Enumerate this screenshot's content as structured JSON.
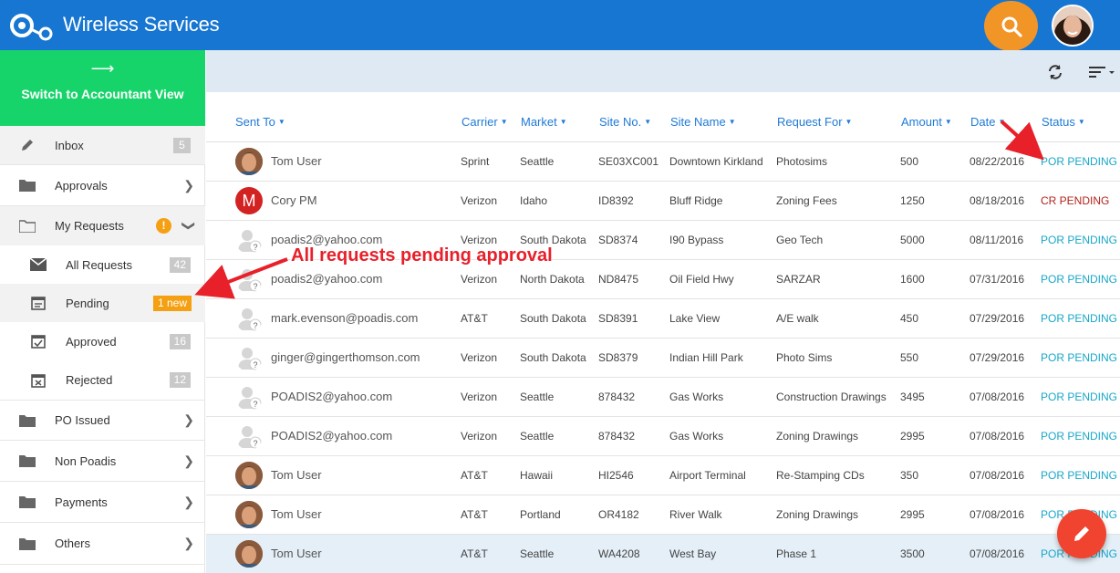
{
  "header": {
    "title": "Wireless Services",
    "logo_icon": "poadis-logo-icon",
    "search_icon": "search-icon",
    "brand_color": "#1676d2",
    "search_color": "#f29527"
  },
  "sidebar": {
    "switch_label": "Switch to Accountant View",
    "switch_icon": "arrow-right-icon",
    "items": [
      {
        "label": "Inbox",
        "icon": "pencil-icon",
        "count": "5"
      },
      {
        "label": "Approvals",
        "icon": "folder-icon"
      },
      {
        "label": "My Requests",
        "icon": "folder-open-icon",
        "warn": "!"
      },
      {
        "label": "All Requests",
        "icon": "mail-icon",
        "count": "42"
      },
      {
        "label": "Pending",
        "icon": "calendar-icon",
        "count": "1 new"
      },
      {
        "label": "Approved",
        "icon": "calendar-check-icon",
        "count": "16"
      },
      {
        "label": "Rejected",
        "icon": "calendar-x-icon",
        "count": "12"
      },
      {
        "label": "PO Issued",
        "icon": "folder-icon"
      },
      {
        "label": "Non Poadis",
        "icon": "folder-icon"
      },
      {
        "label": "Payments",
        "icon": "folder-icon"
      },
      {
        "label": "Others",
        "icon": "folder-icon"
      }
    ]
  },
  "toolbar": {
    "refresh_icon": "refresh-icon",
    "sort_icon": "sort-icon"
  },
  "table": {
    "columns": [
      "Sent To",
      "Carrier",
      "Market",
      "Site No.",
      "Site Name",
      "Request For",
      "Amount",
      "Date",
      "Status"
    ],
    "rows": [
      {
        "sent_to": "Tom User",
        "avatar": "photo",
        "carrier": "Sprint",
        "market": "Seattle",
        "site_no": "SE03XC001",
        "site_name": "Downtown Kirkland",
        "request_for": "Photosims",
        "amount": "500",
        "date": "08/22/2016",
        "status": "POR PENDING"
      },
      {
        "sent_to": "Cory PM",
        "avatar": "letter",
        "avatar_letter": "M",
        "carrier": "Verizon",
        "market": "Idaho",
        "site_no": "ID8392",
        "site_name": "Bluff Ridge",
        "request_for": "Zoning Fees",
        "amount": "1250",
        "date": "08/18/2016",
        "status": "CR PENDING"
      },
      {
        "sent_to": "poadis2@yahoo.com",
        "avatar": "ghost",
        "carrier": "Verizon",
        "market": "South Dakota",
        "site_no": "SD8374",
        "site_name": "I90 Bypass",
        "request_for": "Geo Tech",
        "amount": "5000",
        "date": "08/11/2016",
        "status": "POR PENDING"
      },
      {
        "sent_to": "poadis2@yahoo.com",
        "avatar": "ghost",
        "carrier": "Verizon",
        "market": "North Dakota",
        "site_no": "ND8475",
        "site_name": "Oil Field Hwy",
        "request_for": "SARZAR",
        "amount": "1600",
        "date": "07/31/2016",
        "status": "POR PENDING"
      },
      {
        "sent_to": "mark.evenson@poadis.com",
        "avatar": "ghost",
        "carrier": "AT&T",
        "market": "South Dakota",
        "site_no": "SD8391",
        "site_name": "Lake View",
        "request_for": "A/E walk",
        "amount": "450",
        "date": "07/29/2016",
        "status": "POR PENDING"
      },
      {
        "sent_to": "ginger@gingerthomson.com",
        "avatar": "ghost",
        "carrier": "Verizon",
        "market": "South Dakota",
        "site_no": "SD8379",
        "site_name": "Indian Hill Park",
        "request_for": "Photo Sims",
        "amount": "550",
        "date": "07/29/2016",
        "status": "POR PENDING"
      },
      {
        "sent_to": "POADIS2@yahoo.com",
        "avatar": "ghost",
        "carrier": "Verizon",
        "market": "Seattle",
        "site_no": "878432",
        "site_name": "Gas Works",
        "request_for": "Construction Drawings",
        "amount": "3495",
        "date": "07/08/2016",
        "status": "POR PENDING"
      },
      {
        "sent_to": "POADIS2@yahoo.com",
        "avatar": "ghost",
        "carrier": "Verizon",
        "market": "Seattle",
        "site_no": "878432",
        "site_name": "Gas Works",
        "request_for": "Zoning Drawings",
        "amount": "2995",
        "date": "07/08/2016",
        "status": "POR PENDING"
      },
      {
        "sent_to": "Tom User",
        "avatar": "photo",
        "carrier": "AT&T",
        "market": "Hawaii",
        "site_no": "HI2546",
        "site_name": "Airport Terminal",
        "request_for": "Re-Stamping CDs",
        "amount": "350",
        "date": "07/08/2016",
        "status": "POR PENDING"
      },
      {
        "sent_to": "Tom User",
        "avatar": "photo",
        "carrier": "AT&T",
        "market": "Portland",
        "site_no": "OR4182",
        "site_name": "River Walk",
        "request_for": "Zoning Drawings",
        "amount": "2995",
        "date": "07/08/2016",
        "status": "POR PENDING"
      },
      {
        "sent_to": "Tom User",
        "avatar": "photo",
        "carrier": "AT&T",
        "market": "Seattle",
        "site_no": "WA4208",
        "site_name": "West Bay",
        "request_for": "Phase 1",
        "amount": "3500",
        "date": "07/08/2016",
        "status": "POR PENDING"
      }
    ]
  },
  "annotation": {
    "text": "All requests pending approval",
    "color": "#e8202a"
  },
  "fab": {
    "icon": "pencil-icon",
    "color": "#f04430"
  }
}
